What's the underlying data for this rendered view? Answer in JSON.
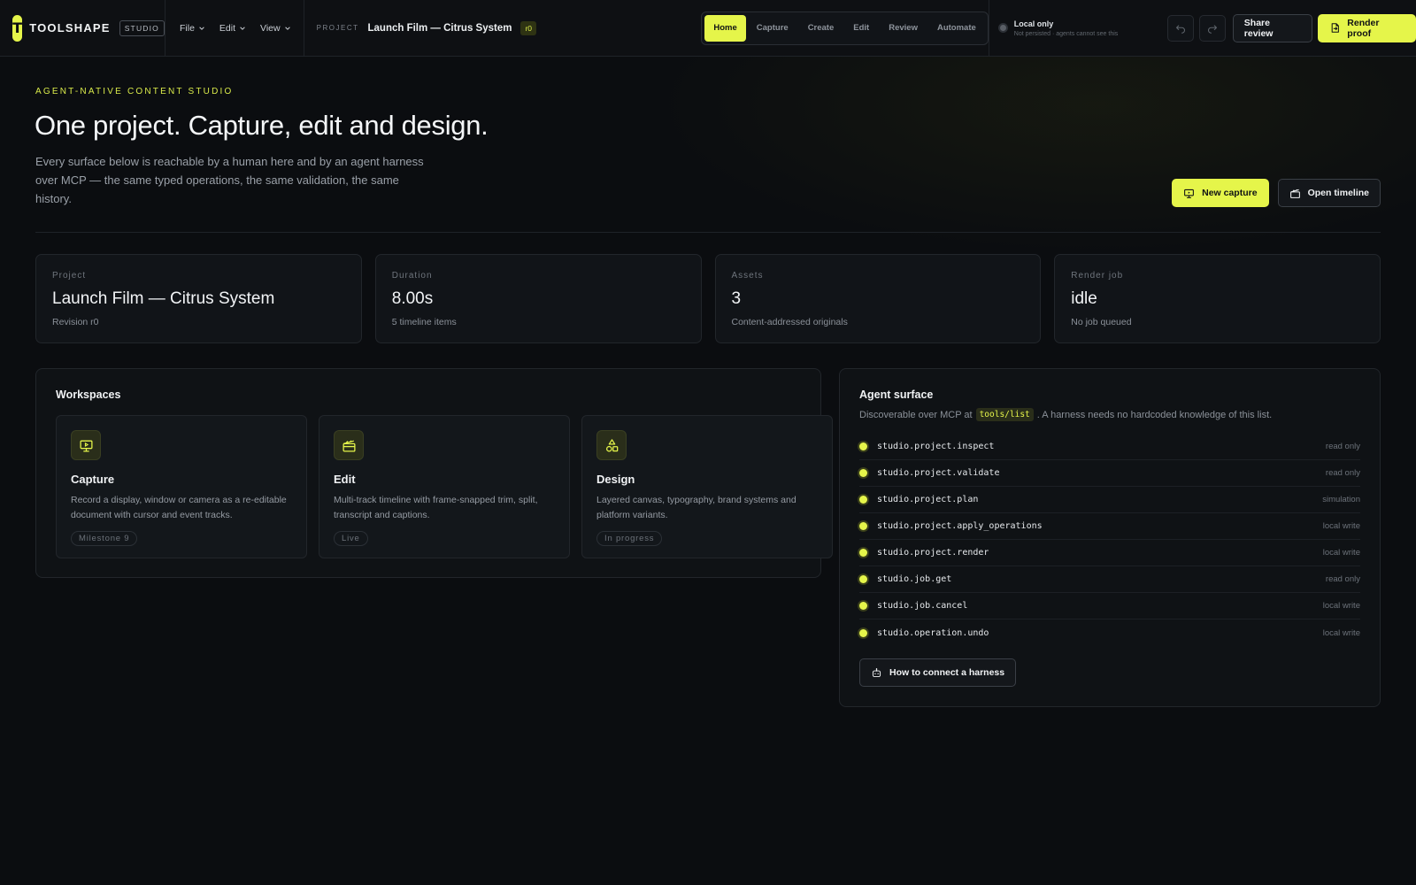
{
  "app": {
    "logo_letter": "T",
    "brand": "TOOLSHAPE",
    "brand_tag": "STUDIO"
  },
  "menus": [
    "File",
    "Edit",
    "View"
  ],
  "project_crumb": {
    "label": "PROJECT",
    "title": "Launch Film — Citrus System",
    "revision": "r0"
  },
  "tabs": [
    {
      "label": "Home",
      "active": true
    },
    {
      "label": "Capture",
      "active": false
    },
    {
      "label": "Create",
      "active": false
    },
    {
      "label": "Edit",
      "active": false
    },
    {
      "label": "Review",
      "active": false
    },
    {
      "label": "Automate",
      "active": false
    }
  ],
  "status": {
    "title": "Local only",
    "subtitle": "Not persisted · agents cannot see this"
  },
  "toolbar": {
    "undo_icon": "undo-icon",
    "redo_icon": "redo-icon",
    "share_label": "Share review",
    "render_label": "Render proof"
  },
  "hero": {
    "eyebrow": "AGENT-NATIVE CONTENT STUDIO",
    "title": "One project. Capture, edit and design.",
    "subtitle": "Every surface below is reachable by a human here and by an agent harness over MCP — the same typed operations, the same validation, the same history.",
    "new_capture_label": "New capture",
    "open_timeline_label": "Open timeline"
  },
  "stats": [
    {
      "label": "Project",
      "value": "Launch Film — Citrus System",
      "meta": "Revision r0"
    },
    {
      "label": "Duration",
      "value": "8.00s",
      "meta": "5 timeline items"
    },
    {
      "label": "Assets",
      "value": "3",
      "meta": "Content-addressed originals"
    },
    {
      "label": "Render job",
      "value": "idle",
      "meta": "No job queued"
    }
  ],
  "workspaces": {
    "title": "Workspaces",
    "items": [
      {
        "name": "Capture",
        "icon": "screen-record-icon",
        "description": "Record a display, window or camera as a re-editable document with cursor and event tracks.",
        "badge": "Milestone 9"
      },
      {
        "name": "Edit",
        "icon": "clapperboard-icon",
        "description": "Multi-track timeline with frame-snapped trim, split, transcript and captions.",
        "badge": "Live"
      },
      {
        "name": "Design",
        "icon": "shapes-icon",
        "description": "Layered canvas, typography, brand systems and platform variants.",
        "badge": "In progress"
      }
    ]
  },
  "agent_surface": {
    "title": "Agent surface",
    "sub_before": "Discoverable over MCP at",
    "sub_code": "tools/list",
    "sub_after": ". A harness needs no hardcoded knowledge of this list.",
    "tools": [
      {
        "name": "studio.project.inspect",
        "scope": "read only"
      },
      {
        "name": "studio.project.validate",
        "scope": "read only"
      },
      {
        "name": "studio.project.plan",
        "scope": "simulation"
      },
      {
        "name": "studio.project.apply_operations",
        "scope": "local write"
      },
      {
        "name": "studio.project.render",
        "scope": "local write"
      },
      {
        "name": "studio.job.get",
        "scope": "read only"
      },
      {
        "name": "studio.job.cancel",
        "scope": "local write"
      },
      {
        "name": "studio.operation.undo",
        "scope": "local write"
      }
    ],
    "connect_label": "How to connect a harness"
  },
  "colors": {
    "accent": "#e5f54a",
    "background": "#0b0d10",
    "panel": "#111418"
  }
}
